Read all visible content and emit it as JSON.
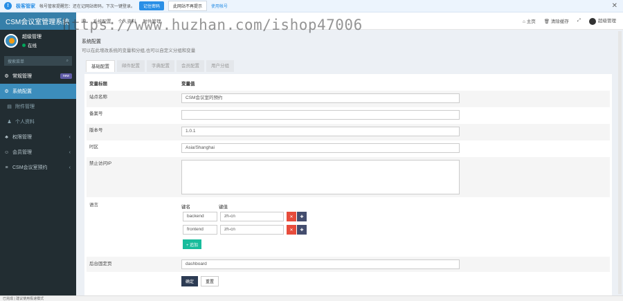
{
  "notification": {
    "brand": "极客管家",
    "message": "帐号管家提醒您：还在记网站密码，下次一键登录。",
    "save_label": "记住密码",
    "dismiss_label": "此网站不再提示",
    "use_label": "使用帐号"
  },
  "sidebar": {
    "app_title": "CSM会议室管理系统",
    "user_name": "超级管理",
    "user_status": "在线",
    "search_placeholder": "搜索菜单",
    "items": [
      {
        "label": "常规管理",
        "badge": "new"
      },
      {
        "label": "系统配置"
      },
      {
        "label": "附件管理"
      },
      {
        "label": "个人资料"
      },
      {
        "label": "权限管理"
      },
      {
        "label": "会员管理"
      },
      {
        "label": "CSM会议室预约"
      }
    ]
  },
  "topbar": {
    "tabs": [
      "ID",
      "系统配置",
      "个人资料",
      "附件管理"
    ],
    "home": "主页",
    "clear_cache": "清除缓存",
    "user": "超级管理"
  },
  "page": {
    "title": "系统配置",
    "subtitle": "可以在此增改系统的变量和分组,也可以自定义分组和变量",
    "tabs": [
      "基础配置",
      "邮件配置",
      "字典配置",
      "会员配置",
      "用户分组"
    ]
  },
  "form": {
    "col_title": "变量标题",
    "col_value": "变量值",
    "rows": [
      {
        "label": "站点名称",
        "value": "CSM会议室的预约"
      },
      {
        "label": "备案号",
        "value": ""
      },
      {
        "label": "版本号",
        "value": "1.0.1"
      },
      {
        "label": "时区",
        "value": "Asia/Shanghai"
      },
      {
        "label": "禁止访问IP",
        "value": ""
      }
    ],
    "lang_label": "语言",
    "lang_key_header": "键名",
    "lang_val_header": "键值",
    "langs": [
      {
        "key": "backend",
        "value": "zh-cn"
      },
      {
        "key": "frontend",
        "value": "zh-cn"
      }
    ],
    "append_label": "+ 追加",
    "index_label": "后台固定页",
    "index_value": "dashboard",
    "submit_label": "确定",
    "reset_label": "重置"
  },
  "statusbar": {
    "text": "已完成 | 建议使用极速模式"
  },
  "watermark": "https://www.huzhan.com/ishop47006"
}
